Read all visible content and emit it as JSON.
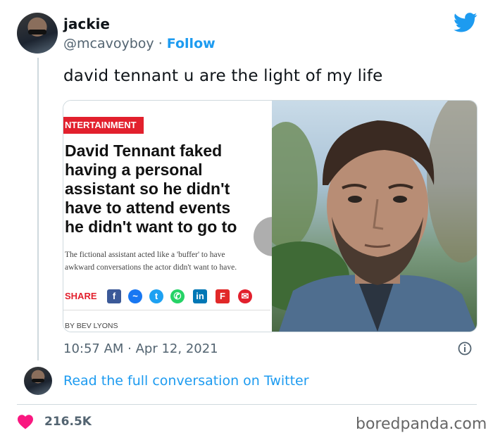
{
  "tweet": {
    "author_name": "jackie",
    "author_handle": "@mcavoyboy",
    "separator": "·",
    "follow_label": "Follow",
    "text": "david tennant u are the light of my life",
    "timestamp": "10:57 AM · Apr 12, 2021",
    "read_full_label": "Read the full conversation on Twitter",
    "like_count": "216.5K"
  },
  "media": {
    "tag": "ENTERTAINMENT",
    "tag_visible": "NTERTAINMENT",
    "headline_lines": [
      "David Tennant faked",
      "having a personal",
      "assistant so he didn't",
      "have to attend events",
      "he didn't want to go to"
    ],
    "sub_lines": [
      "The fictional assistant acted like a 'buffer' to have",
      "awkward conversations the actor didn't want to have."
    ],
    "share_label": "SHARE",
    "byline": "BY BEV LYONS",
    "share_icons": [
      "facebook-icon",
      "messenger-icon",
      "twitter-icon",
      "whatsapp-icon",
      "linkedin-icon",
      "flipboard-icon",
      "email-icon"
    ]
  },
  "colors": {
    "twitter_blue": "#1d9bf0",
    "heart_red": "#f91880",
    "tag_red": "#e2202d"
  },
  "watermark": "boredpanda.com"
}
